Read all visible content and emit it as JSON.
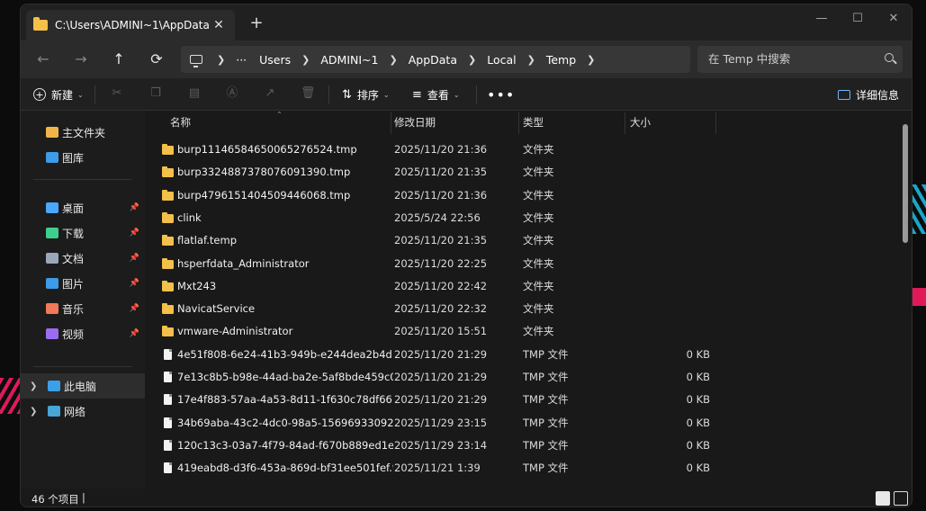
{
  "window": {
    "tab_title": "C:\\Users\\ADMINI~1\\AppData\\"
  },
  "breadcrumbs": [
    "Users",
    "ADMINI~1",
    "AppData",
    "Local",
    "Temp"
  ],
  "search": {
    "placeholder": "在 Temp 中搜索"
  },
  "toolbar": {
    "new_label": "新建",
    "sort_label": "排序",
    "view_label": "查看",
    "details_label": "详细信息"
  },
  "sidebar": {
    "home": "主文件夹",
    "gallery": "图库",
    "quick": [
      {
        "label": "桌面",
        "color": "#4aa8ff"
      },
      {
        "label": "下载",
        "color": "#3ecf8e"
      },
      {
        "label": "文档",
        "color": "#9aa7b8"
      },
      {
        "label": "图片",
        "color": "#3d9be9"
      },
      {
        "label": "音乐",
        "color": "#f07a5a"
      },
      {
        "label": "视频",
        "color": "#9a6df0"
      }
    ],
    "this_pc": "此电脑",
    "network": "网络"
  },
  "columns": {
    "name": "名称",
    "date": "修改日期",
    "type": "类型",
    "size": "大小"
  },
  "files": [
    {
      "name": "burp11146584650065276524.tmp",
      "date": "2025/11/20 21:36",
      "type": "文件夹",
      "size": "",
      "kind": "folder"
    },
    {
      "name": "burp3324887378076091390.tmp",
      "date": "2025/11/20 21:35",
      "type": "文件夹",
      "size": "",
      "kind": "folder"
    },
    {
      "name": "burp4796151404509446068.tmp",
      "date": "2025/11/20 21:36",
      "type": "文件夹",
      "size": "",
      "kind": "folder"
    },
    {
      "name": "clink",
      "date": "2025/5/24 22:56",
      "type": "文件夹",
      "size": "",
      "kind": "folder"
    },
    {
      "name": "flatlaf.temp",
      "date": "2025/11/20 21:35",
      "type": "文件夹",
      "size": "",
      "kind": "folder"
    },
    {
      "name": "hsperfdata_Administrator",
      "date": "2025/11/20 22:25",
      "type": "文件夹",
      "size": "",
      "kind": "folder"
    },
    {
      "name": "Mxt243",
      "date": "2025/11/20 22:42",
      "type": "文件夹",
      "size": "",
      "kind": "folder"
    },
    {
      "name": "NavicatService",
      "date": "2025/11/20 22:32",
      "type": "文件夹",
      "size": "",
      "kind": "folder"
    },
    {
      "name": "vmware-Administrator",
      "date": "2025/11/20 15:51",
      "type": "文件夹",
      "size": "",
      "kind": "folder"
    },
    {
      "name": "4e51f808-6e24-41b3-949b-e244dea2b4d...",
      "date": "2025/11/20 21:29",
      "type": "TMP 文件",
      "size": "0 KB",
      "kind": "file"
    },
    {
      "name": "7e13c8b5-b98e-44ad-ba2e-5af8bde459c0....",
      "date": "2025/11/20 21:29",
      "type": "TMP 文件",
      "size": "0 KB",
      "kind": "file"
    },
    {
      "name": "17e4f883-57aa-4a53-8d11-1f630c78df66.t...",
      "date": "2025/11/20 21:29",
      "type": "TMP 文件",
      "size": "0 KB",
      "kind": "file"
    },
    {
      "name": "34b69aba-43c2-4dc0-98a5-15696933092...",
      "date": "2025/11/29 23:15",
      "type": "TMP 文件",
      "size": "0 KB",
      "kind": "file"
    },
    {
      "name": "120c13c3-03a7-4f79-84ad-f670b889ed1e...",
      "date": "2025/11/29 23:14",
      "type": "TMP 文件",
      "size": "0 KB",
      "kind": "file"
    },
    {
      "name": "419eabd8-d3f6-453a-869d-bf31ee501fef.t...",
      "date": "2025/11/21 1:39",
      "type": "TMP 文件",
      "size": "0 KB",
      "kind": "file"
    }
  ],
  "status": {
    "count": "46 个项目"
  }
}
